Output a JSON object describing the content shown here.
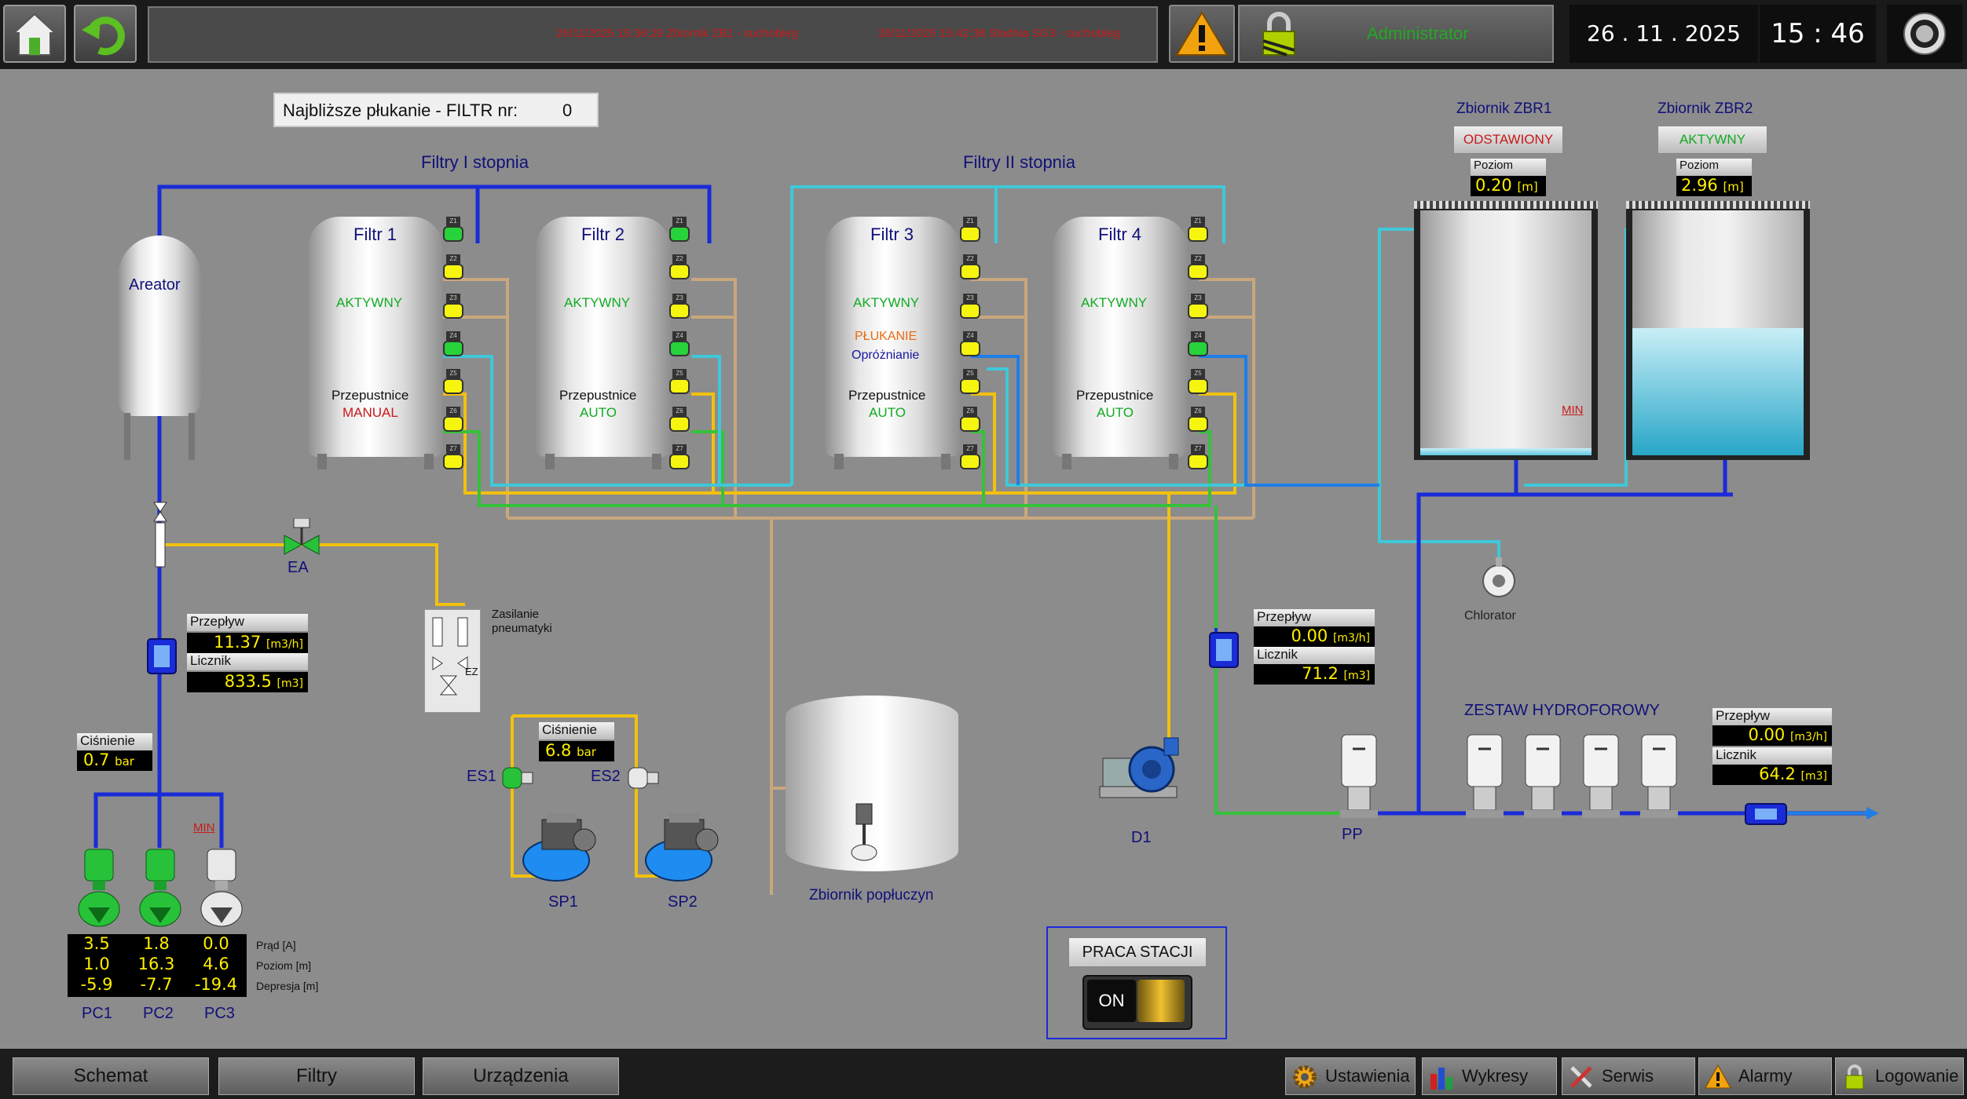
{
  "topbar": {
    "messages": [
      "26/11/2025 15:36:29 Zbiornik ZB1 - suchobieg",
      "26/11/2025 15:42:38 Studnia SG3 - suchobieg"
    ],
    "user": "Administrator",
    "date": "26 . 11 . 2025",
    "time": "15 : 46"
  },
  "next_flush": {
    "label": "Najbliższe płukanie - FILTR nr:",
    "value": "0"
  },
  "sections": {
    "stage1": "Filtry I stopnia",
    "stage2": "Filtry II stopnia"
  },
  "aerator": {
    "label": "Areator"
  },
  "filters": [
    {
      "name": "Filtr 1",
      "state": "AKTYWNY",
      "mode_label": "Przepustnice",
      "mode": "MANUAL",
      "mode_color": "#c81a1a"
    },
    {
      "name": "Filtr 2",
      "state": "AKTYWNY",
      "mode_label": "Przepustnice",
      "mode": "AUTO",
      "mode_color": "#11aa22"
    },
    {
      "name": "Filtr 3",
      "state": "AKTYWNY",
      "extra1": "PŁUKANIE",
      "extra2": "Opróżnianie",
      "mode_label": "Przepustnice",
      "mode": "AUTO",
      "mode_color": "#11aa22"
    },
    {
      "name": "Filtr 4",
      "state": "AKTYWNY",
      "mode_label": "Przepustnice",
      "mode": "AUTO",
      "mode_color": "#11aa22"
    }
  ],
  "valve_tags": [
    "Z1",
    "Z2",
    "Z3",
    "Z4",
    "Z5",
    "Z6",
    "Z7"
  ],
  "tanks": [
    {
      "name": "Zbiornik ZBR1",
      "status": "ODSTAWIONY",
      "status_color": "#c81a1a",
      "level_label": "Poziom",
      "level": "0.20",
      "unit": "[m]",
      "min_label": "MIN",
      "fill": 0.03
    },
    {
      "name": "Zbiornik ZBR2",
      "status": "AKTYWNY",
      "status_color": "#11aa22",
      "level_label": "Poziom",
      "level": "2.96",
      "unit": "[m]",
      "fill": 0.52
    }
  ],
  "ea": {
    "label": "EA"
  },
  "flow_left": {
    "flow_label": "Przepływ",
    "flow": "11.37",
    "flow_unit": "[m3/h]",
    "counter_label": "Licznik",
    "counter": "833.5",
    "counter_unit": "[m3]"
  },
  "pressure_left": {
    "label": "Ciśnienie",
    "value": "0.7",
    "unit": "bar"
  },
  "pneumatic": {
    "label": "Zasilanie pneumatyki",
    "ez": "EZ"
  },
  "pressure_mid": {
    "label": "Ciśnienie",
    "value": "6.8",
    "unit": "bar"
  },
  "es": {
    "es1": "ES1",
    "es2": "ES2"
  },
  "compressors": {
    "sp1": "SP1",
    "sp2": "SP2"
  },
  "pumps": {
    "min_label": "MIN",
    "names": [
      "PC1",
      "PC2",
      "PC3"
    ],
    "row_labels": [
      "Prąd [A]",
      "Poziom [m]",
      "Depresja [m]"
    ],
    "values": [
      [
        "3.5",
        "1.8",
        "0.0"
      ],
      [
        "1.0",
        "16.3",
        "4.6"
      ],
      [
        "-5.9",
        "-7.7",
        "-19.4"
      ]
    ]
  },
  "backwash_tank": {
    "label": "Zbiornik popłuczyn"
  },
  "d1": {
    "label": "D1"
  },
  "flow_right": {
    "flow_label": "Przepływ",
    "flow": "0.00",
    "flow_unit": "[m3/h]",
    "counter_label": "Licznik",
    "counter": "71.2",
    "counter_unit": "[m3]"
  },
  "chlorator": {
    "label": "Chlorator"
  },
  "hydro": {
    "title": "ZESTAW HYDROFOROWY",
    "pp": "PP"
  },
  "flow_out": {
    "flow_label": "Przepływ",
    "flow": "0.00",
    "flow_unit": "[m3/h]",
    "counter_label": "Licznik",
    "counter": "64.2",
    "counter_unit": "[m3]"
  },
  "station": {
    "label": "PRACA STACJI",
    "switch": "ON"
  },
  "nav": {
    "schemat": "Schemat",
    "filtry": "Filtry",
    "urzadzenia": "Urządzenia"
  },
  "tools": {
    "ustawienia": "Ustawienia",
    "wykresy": "Wykresy",
    "serwis": "Serwis",
    "alarmy": "Alarmy",
    "logowanie": "Logowanie"
  }
}
